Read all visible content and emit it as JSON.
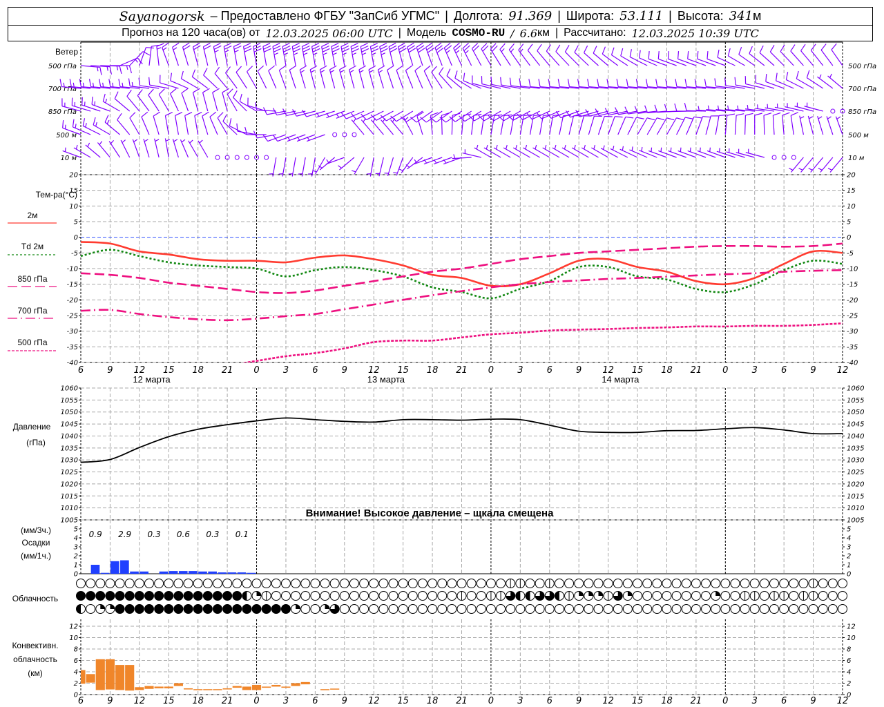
{
  "header": {
    "station": "Sayanogorsk",
    "provider": "– Предоставлено ФГБУ \"ЗапСиб УГМС\"",
    "lon_label": "Долгота:",
    "lon": "91.369",
    "lat_label": "Широта:",
    "lat": "53.111",
    "alt_label": "Высота:",
    "alt": "341",
    "alt_unit": "м",
    "forecast_label": "Прогноз на 120 часа(ов) от",
    "forecast_start": "12.03.2025 06:00 UTC",
    "model_label": "Модель",
    "model": "COSMO-RU",
    "model_sep": "/",
    "resolution": "6.6",
    "resolution_unit": "км",
    "calc_label": "Рассчитано:",
    "calc_time": "12.03.2025 10:39 UTC",
    "divider": "|"
  },
  "time_axis": {
    "hour_labels": [
      "6",
      "9",
      "12",
      "15",
      "18",
      "21",
      "0",
      "3",
      "6",
      "9",
      "12",
      "15",
      "18",
      "21",
      "0",
      "3",
      "6",
      "9",
      "12",
      "15",
      "18",
      "21",
      "0",
      "3",
      "6",
      "9",
      "12"
    ],
    "dates": [
      "12 марта",
      "13 марта",
      "14 марта"
    ]
  },
  "chart_data": [
    {
      "type": "wind-barbs",
      "title": "Ветер",
      "color": "#8000ff",
      "speed_unit_note": "",
      "levels": [
        {
          "name": "500 гПа",
          "dir": [
            95,
            90,
            20,
            340,
            345,
            350,
            350,
            350,
            350,
            350,
            350,
            345,
            340,
            335,
            330,
            325,
            320,
            315,
            310,
            300,
            290,
            290,
            290,
            305,
            315,
            320,
            325
          ],
          "speed": [
            15,
            15,
            10,
            15,
            20,
            25,
            30,
            35,
            35,
            35,
            35,
            30,
            30,
            25,
            20,
            15,
            10,
            10,
            10,
            10,
            10,
            10,
            10,
            10,
            10,
            10,
            10
          ]
        },
        {
          "name": "700 гПа",
          "dir": [
            275,
            275,
            275,
            280,
            300,
            320,
            330,
            340,
            345,
            345,
            345,
            340,
            335,
            310,
            285,
            280,
            275,
            275,
            275,
            275,
            275,
            275,
            275,
            280,
            290,
            300,
            310
          ],
          "speed": [
            15,
            15,
            15,
            10,
            10,
            10,
            10,
            10,
            15,
            15,
            15,
            10,
            10,
            10,
            10,
            10,
            10,
            10,
            10,
            10,
            10,
            10,
            10,
            10,
            10,
            10,
            5
          ]
        },
        {
          "name": "850 гПа",
          "dir": [
            285,
            290,
            320,
            330,
            345,
            345,
            300,
            260,
            255,
            250,
            245,
            240,
            235,
            235,
            240,
            240,
            245,
            250,
            255,
            260,
            265,
            270,
            275,
            275,
            280,
            285,
            0
          ],
          "speed": [
            15,
            15,
            10,
            10,
            10,
            10,
            10,
            10,
            10,
            5,
            10,
            10,
            10,
            10,
            10,
            10,
            10,
            10,
            10,
            10,
            10,
            10,
            5,
            5,
            5,
            5,
            0
          ]
        },
        {
          "name": "500 м",
          "dir": [
            290,
            300,
            330,
            350,
            350,
            330,
            280,
            250,
            250,
            0,
            320,
            320,
            355,
            5,
            10,
            10,
            10,
            15,
            20,
            30,
            30,
            20,
            5,
            0,
            355,
            345,
            340
          ],
          "speed": [
            15,
            15,
            10,
            10,
            10,
            10,
            10,
            10,
            5,
            0,
            5,
            5,
            10,
            10,
            10,
            10,
            10,
            10,
            10,
            10,
            10,
            10,
            10,
            10,
            10,
            5,
            5
          ]
        },
        {
          "name": "10 м",
          "dir": [
            290,
            320,
            340,
            350,
            330,
            330,
            0,
            190,
            190,
            250,
            190,
            200,
            250,
            250,
            300,
            300,
            300,
            300,
            300,
            295,
            290,
            290,
            290,
            285,
            0,
            220,
            220
          ],
          "speed": [
            5,
            5,
            5,
            5,
            5,
            0,
            0,
            5,
            5,
            5,
            5,
            5,
            5,
            5,
            5,
            5,
            5,
            5,
            5,
            5,
            5,
            5,
            5,
            5,
            0,
            5,
            5
          ]
        }
      ]
    },
    {
      "type": "line",
      "title": "Тем-ра(°C)",
      "ylim": [
        -40,
        20
      ],
      "yticks": [
        20,
        15,
        10,
        5,
        0,
        -5,
        -10,
        -15,
        -20,
        -25,
        -30,
        -35,
        -40
      ],
      "grid": true,
      "zero_line_color": "#3050ff",
      "series": [
        {
          "name": "2м",
          "color": "#ff3b30",
          "style": "solid",
          "values": [
            -1.5,
            -2,
            -4.5,
            -5.5,
            -7,
            -7.5,
            -7.5,
            -8,
            -6.5,
            -5.8,
            -7,
            -9,
            -12,
            -13,
            -15.5,
            -15,
            -11.5,
            -7.5,
            -7,
            -9.5,
            -11,
            -14,
            -15,
            -13,
            -8.5,
            -4.5,
            -5
          ]
        },
        {
          "name": "Td 2м",
          "color": "#118811",
          "style": "dotted",
          "values": [
            -6,
            -4,
            -6,
            -8,
            -9,
            -9.5,
            -10,
            -12.5,
            -10.5,
            -9.5,
            -10.5,
            -12.5,
            -16,
            -17.5,
            -19.5,
            -16.5,
            -14,
            -9.5,
            -9.5,
            -12.5,
            -13.5,
            -16.5,
            -17.5,
            -15,
            -10.5,
            -7.5,
            -8.5
          ]
        },
        {
          "name": "850 гПа",
          "color": "#ee1080",
          "style": "dashed",
          "values": [
            -11.5,
            -12,
            -13,
            -14.5,
            -15.5,
            -16.5,
            -17.5,
            -17.8,
            -17,
            -15.5,
            -14,
            -12.5,
            -11,
            -10,
            -8.5,
            -7,
            -6,
            -5,
            -4.5,
            -4,
            -3.5,
            -3,
            -2.8,
            -2.8,
            -3,
            -2.8,
            -2
          ]
        },
        {
          "name": "700 гПа",
          "color": "#ee1080",
          "style": "dashdot",
          "values": [
            -23.5,
            -23.2,
            -24.5,
            -25.5,
            -26.2,
            -26.5,
            -26,
            -25.2,
            -24.5,
            -23,
            -21.5,
            -20,
            -18.5,
            -17.2,
            -16,
            -15,
            -14.3,
            -13.8,
            -13.3,
            -13,
            -12.6,
            -12.2,
            -11.8,
            -11.5,
            -11,
            -10.7,
            -10.5
          ]
        },
        {
          "name": "500 гПа",
          "color": "#ee1080",
          "style": "dotdash",
          "values": [
            null,
            null,
            null,
            null,
            null,
            -41,
            -39.5,
            -38,
            -37,
            -35.5,
            -33.5,
            -33,
            -33,
            -32,
            -31,
            -30.5,
            -29.8,
            -29.5,
            -29.3,
            -29,
            -28.8,
            -28.5,
            -28.5,
            -28.3,
            -28.3,
            -28,
            -27.5
          ]
        }
      ]
    },
    {
      "type": "line",
      "title": "Давление",
      "ylabel": "(гПа)",
      "ylim": [
        1005,
        1060
      ],
      "yticks": [
        1060,
        1055,
        1050,
        1045,
        1040,
        1035,
        1030,
        1025,
        1020,
        1015,
        1010,
        1005
      ],
      "color": "#000000",
      "values": [
        1029,
        1030.2,
        1035.2,
        1039.7,
        1042.8,
        1044.7,
        1046.3,
        1047.5,
        1046.8,
        1046.1,
        1045.8,
        1046.8,
        1046.8,
        1046.6,
        1047,
        1046.8,
        1044.5,
        1042,
        1041.5,
        1041.5,
        1042.2,
        1042.3,
        1043,
        1043.5,
        1042.5,
        1041,
        1041
      ],
      "note": "Внимание! Высокое давление – щкала смещена"
    },
    {
      "type": "bar",
      "title": "Осадки",
      "unit_3h": "(мм/3ч.)",
      "unit_1h": "(мм/1ч.)",
      "ylim": [
        0,
        5
      ],
      "yticks": [
        5,
        4,
        3,
        2,
        1,
        0
      ],
      "color": "#2040ff",
      "hourly": [
        0,
        1.0,
        0.1,
        1.4,
        1.5,
        0.25,
        0.25,
        0,
        0.25,
        0.3,
        0.3,
        0.3,
        0.25,
        0.25,
        0.15,
        0.15,
        0.15,
        0.1
      ],
      "totals_3h": [
        "0.9",
        "2.9",
        "0.3",
        "0.6",
        "0.3",
        "0.1"
      ]
    },
    {
      "type": "symbols",
      "title": "Облачность",
      "unit": "oktas",
      "rows": [
        [
          0,
          0,
          0,
          0,
          0,
          0,
          0,
          0,
          0,
          0,
          0,
          0,
          0,
          0,
          0,
          0,
          0,
          0,
          0,
          0,
          0,
          0,
          0,
          0,
          0,
          0,
          0,
          0,
          0,
          0,
          0,
          0,
          0,
          0,
          0,
          0,
          0,
          0,
          0,
          0,
          0,
          0,
          0,
          0,
          1,
          1,
          0,
          0,
          1,
          0,
          0,
          0,
          0,
          0,
          0,
          0,
          0,
          0,
          0,
          0,
          0,
          0,
          0,
          0,
          0,
          0,
          0,
          0,
          0,
          0,
          0,
          0,
          0,
          0,
          0,
          1,
          0,
          0,
          0
        ],
        [
          8,
          8,
          8,
          8,
          8,
          8,
          8,
          8,
          8,
          8,
          8,
          8,
          8,
          8,
          8,
          8,
          8,
          4,
          2,
          1,
          0,
          0,
          0,
          0,
          0,
          0,
          0,
          0,
          0,
          0,
          0,
          0,
          0,
          0,
          0,
          0,
          0,
          0,
          0,
          1,
          0,
          0,
          1,
          1,
          6,
          4,
          4,
          6,
          6,
          4,
          1,
          2,
          2,
          2,
          1,
          6,
          2,
          0,
          0,
          0,
          0,
          0,
          0,
          0,
          0,
          2,
          0,
          0,
          1,
          1,
          0,
          1,
          1,
          0,
          1,
          1,
          0,
          0,
          0
        ],
        [
          4,
          0,
          2,
          2,
          8,
          8,
          8,
          8,
          8,
          8,
          8,
          8,
          8,
          8,
          8,
          8,
          8,
          8,
          8,
          8,
          8,
          8,
          2,
          0,
          0,
          2,
          6,
          0,
          0,
          0,
          0,
          0,
          0,
          0,
          0,
          0,
          0,
          0,
          0,
          0,
          0,
          0,
          0,
          0,
          0,
          0,
          0,
          0,
          0,
          0,
          0,
          0,
          0,
          0,
          0,
          0,
          0,
          0,
          0,
          0,
          0,
          0,
          0,
          0,
          0,
          0,
          0,
          0,
          0,
          0,
          0,
          0,
          0,
          0,
          0,
          0,
          0,
          0,
          0
        ]
      ]
    },
    {
      "type": "range-bar",
      "title_lines": [
        "Конвективн.",
        "облачность",
        "(км)"
      ],
      "ylim": [
        0,
        13
      ],
      "yticks": [
        12,
        10,
        8,
        6,
        4,
        2,
        0
      ],
      "color": "#f0862a",
      "layers": [
        [
          1.9,
          4.3
        ],
        [
          2.1,
          3.6
        ],
        [
          0.8,
          6.2
        ],
        [
          0.9,
          6.2
        ],
        [
          0.8,
          5.2
        ],
        [
          0.7,
          5.2
        ],
        [
          0.8,
          1.3
        ],
        [
          1.0,
          1.5
        ],
        [
          1.1,
          1.4
        ],
        [
          1.1,
          1.4
        ],
        [
          1.5,
          2.0
        ],
        [
          0.9,
          1.1
        ],
        [
          0.8,
          0.95
        ],
        [
          0.8,
          0.95
        ],
        [
          0.8,
          0.95
        ],
        [
          0.9,
          1.1
        ],
        [
          1.2,
          1.5
        ],
        [
          0.8,
          1.4
        ],
        [
          0.8,
          1.7
        ],
        [
          1.2,
          1.4
        ],
        [
          1.4,
          1.7
        ],
        [
          1.2,
          1.4
        ],
        [
          1.5,
          2.0
        ],
        [
          1.8,
          2.2
        ],
        null,
        [
          0.85,
          0.95
        ],
        [
          0.95,
          1.05
        ]
      ]
    }
  ]
}
